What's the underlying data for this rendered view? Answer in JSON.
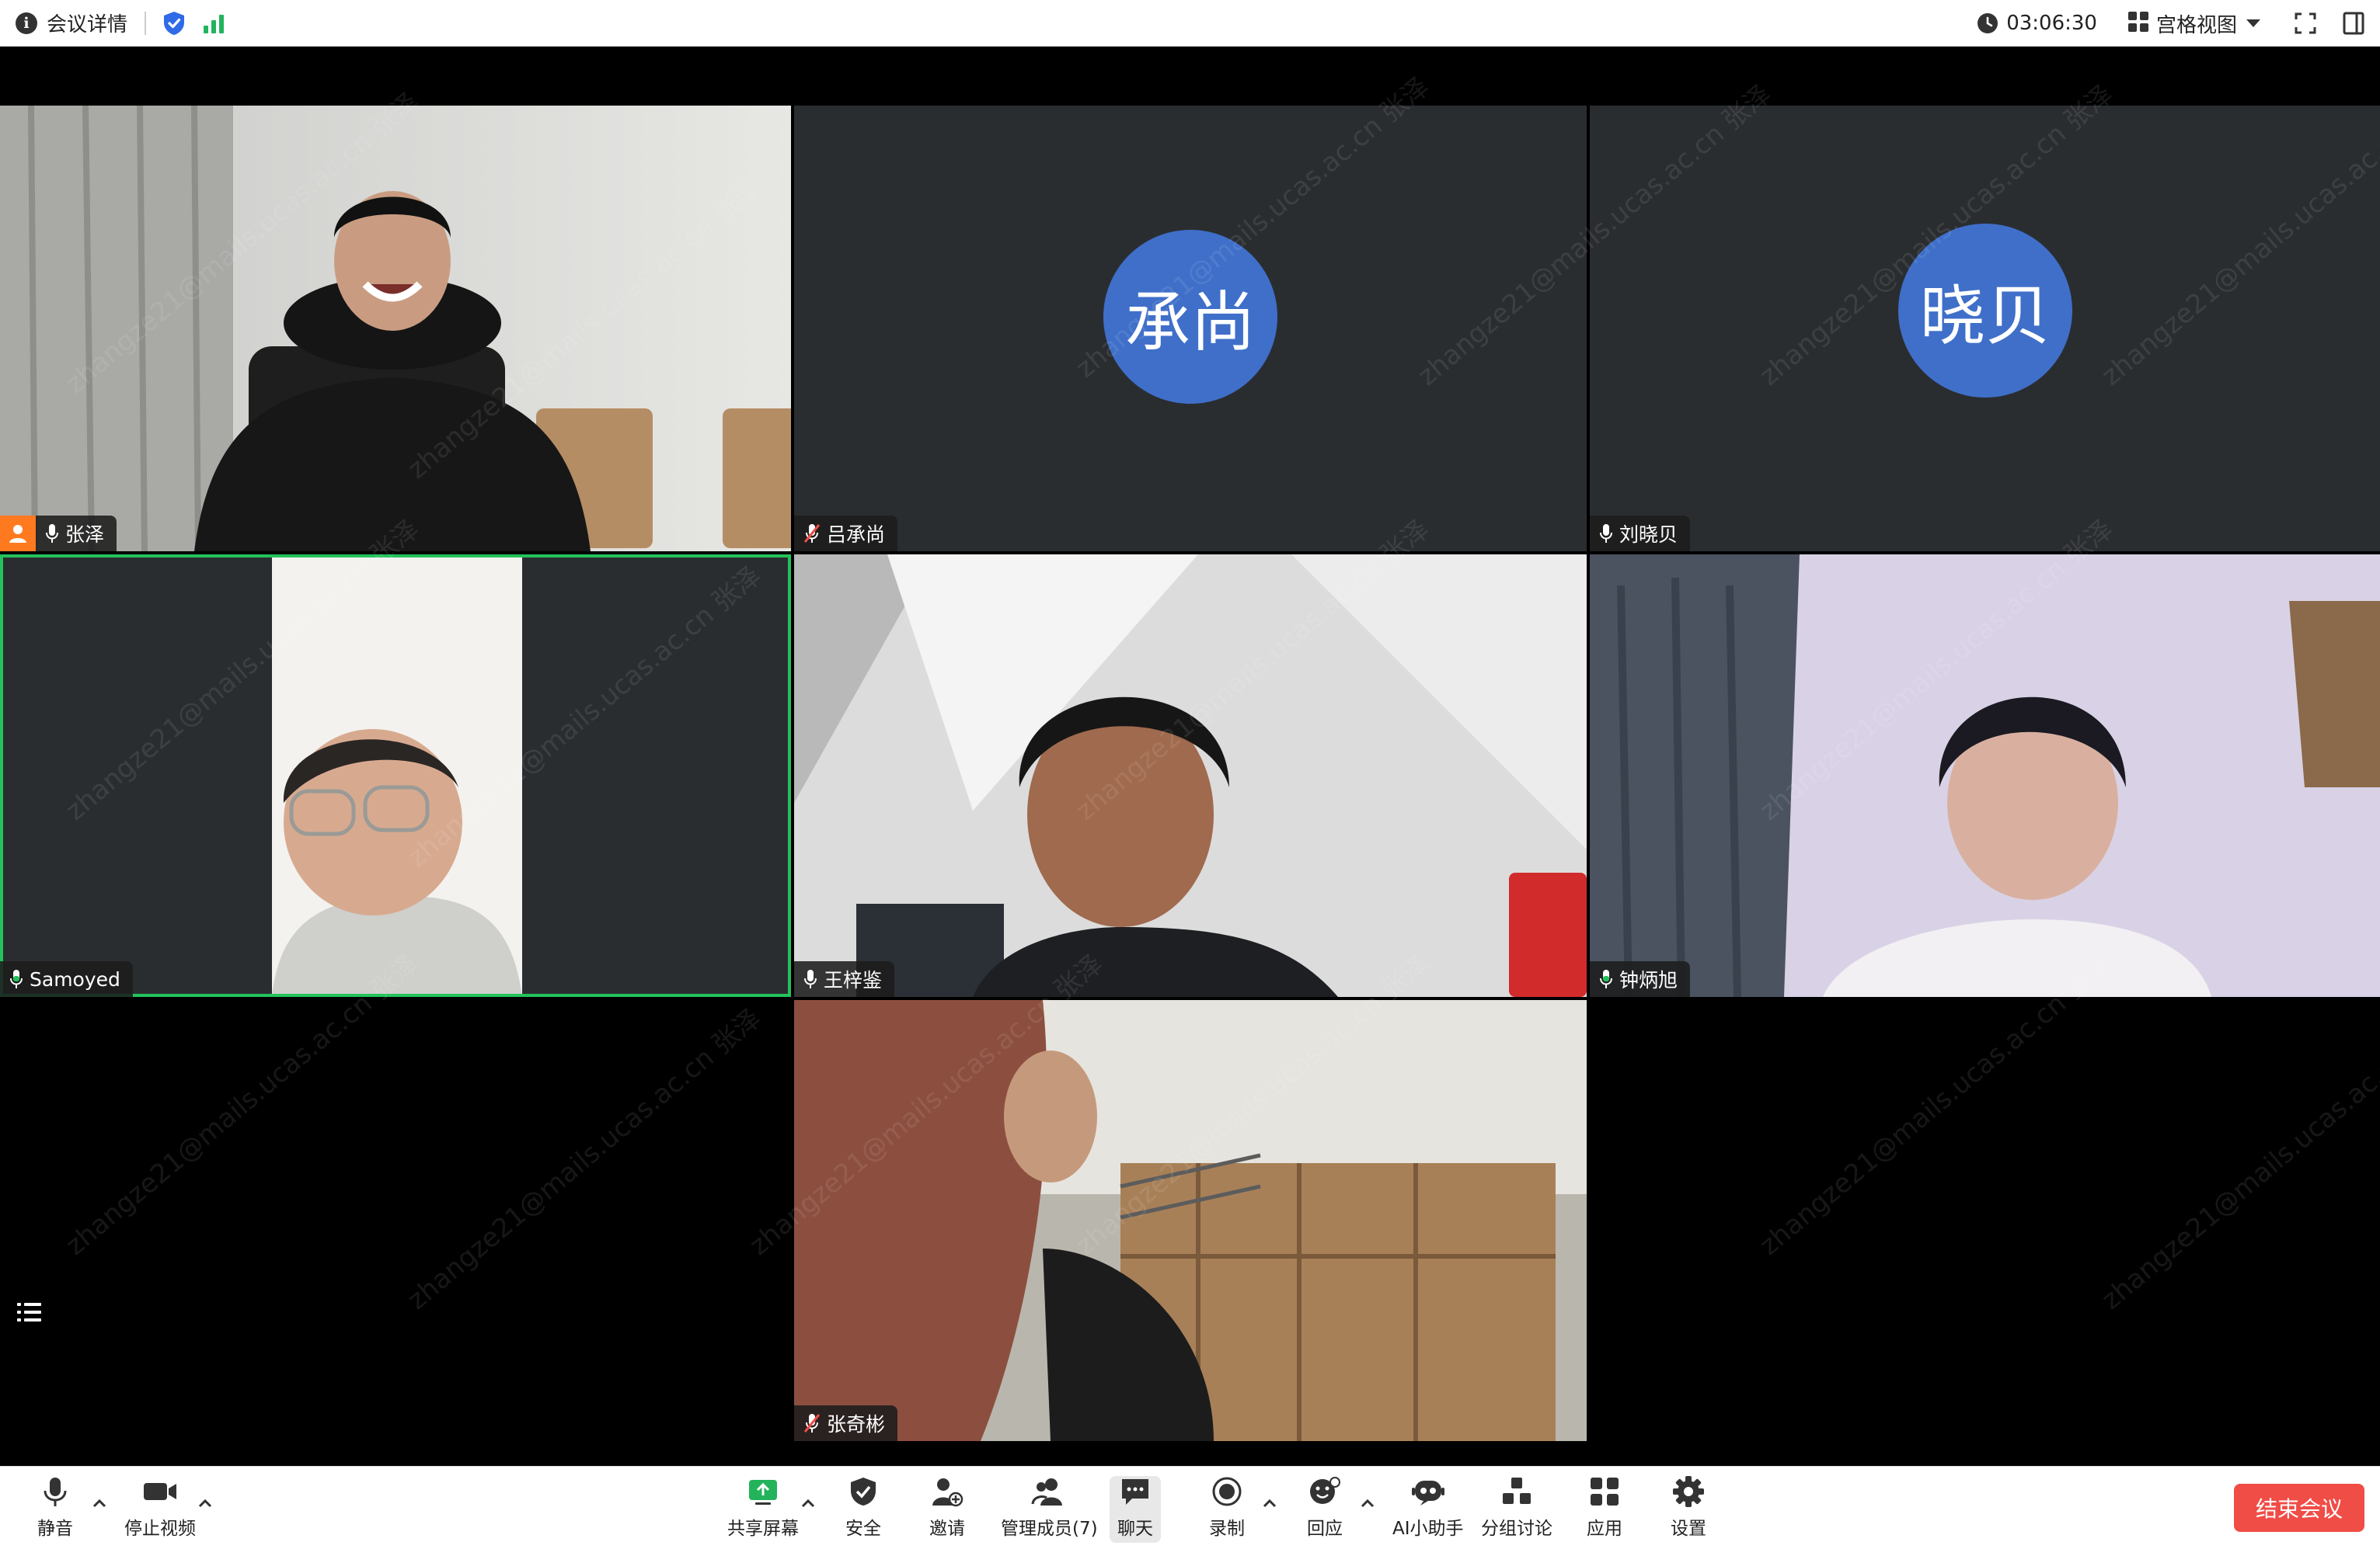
{
  "top_bar": {
    "meeting_info_label": "会议详情",
    "timer": "03:06:30",
    "view_label": "宫格视图"
  },
  "participants": [
    {
      "name": "张泽",
      "host": true,
      "mic": "on",
      "video": true
    },
    {
      "name": "吕承尚",
      "avatar_text": "承尚",
      "mic": "muted",
      "video": false
    },
    {
      "name": "刘晓贝",
      "avatar_text": "晓贝",
      "mic": "on",
      "video": false
    },
    {
      "name": "Samoyed",
      "mic": "on",
      "video": true,
      "active_speaker": true
    },
    {
      "name": "王梓鉴",
      "mic": "on",
      "video": true
    },
    {
      "name": "钟炳旭",
      "mic": "on",
      "video": true
    },
    {
      "name": "张奇彬",
      "mic": "muted",
      "video": true
    }
  ],
  "watermark": "zhangze21@mails.ucas.ac.cn 张泽",
  "toolbar": {
    "mute": "静音",
    "stop_video": "停止视频",
    "share_screen": "共享屏幕",
    "security": "安全",
    "invite": "邀请",
    "participants": "管理成员(7)",
    "chat": "聊天",
    "record": "录制",
    "reactions": "回应",
    "ai_assistant": "AI小助手",
    "breakout": "分组讨论",
    "apps": "应用",
    "settings": "设置",
    "end_meeting": "结束会议"
  },
  "colors": {
    "accent_blue": "#2f6be6",
    "active_speaker_border": "#23c25b",
    "avatar_bg": "#3f6fc9",
    "end_button": "#f04d47",
    "host_badge": "#ff7a1f",
    "tile_bg": "#2a2d30"
  }
}
